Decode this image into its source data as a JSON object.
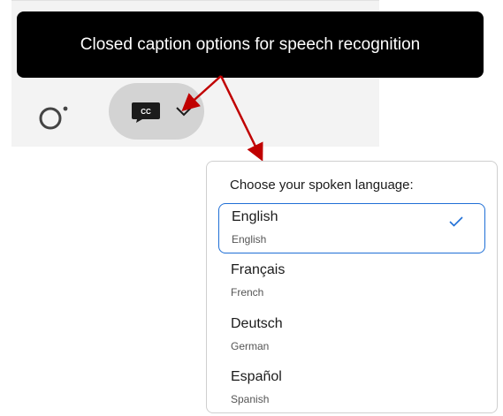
{
  "tooltip": {
    "text": "Closed caption options for speech recognition"
  },
  "toolbar": {
    "ring_icon": "recording-ring-icon",
    "cc_icon": "closed-caption-icon",
    "cc_icon_text": "CC",
    "chevron_icon": "chevron-down-icon"
  },
  "dropdown": {
    "title": "Choose your spoken language:",
    "selected_index": 0,
    "items": [
      {
        "label": "English",
        "sublabel": "English"
      },
      {
        "label": "Français",
        "sublabel": "French"
      },
      {
        "label": "Deutsch",
        "sublabel": "German"
      },
      {
        "label": "Español",
        "sublabel": "Spanish"
      }
    ]
  },
  "colors": {
    "annotation_arrow": "#c00000",
    "selection_accent": "#1f6fd6",
    "tooltip_bg": "#000000",
    "pill_bg": "#d3d3d3"
  }
}
